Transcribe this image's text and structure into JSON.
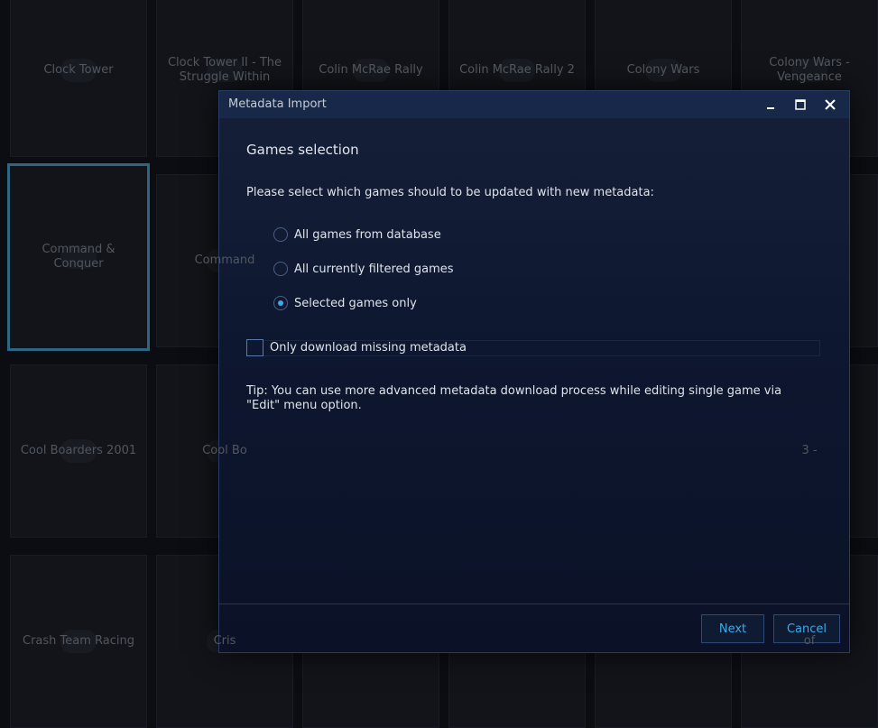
{
  "library": {
    "tiles": [
      {
        "title": "Clock Tower"
      },
      {
        "title": "Clock Tower II - The Struggle Within"
      },
      {
        "title": "Colin McRae Rally"
      },
      {
        "title": "Colin McRae Rally 2"
      },
      {
        "title": "Colony Wars"
      },
      {
        "title": "Colony Wars - Vengeance"
      },
      {
        "title": "Command & Conquer"
      },
      {
        "title": "Command"
      },
      {
        "title": ""
      },
      {
        "title": ""
      },
      {
        "title": ""
      },
      {
        "title": ""
      },
      {
        "title": "Cool Boarders 2001"
      },
      {
        "title": "Cool Bo"
      },
      {
        "title": ""
      },
      {
        "title": ""
      },
      {
        "title": ""
      },
      {
        "title": "3 -"
      },
      {
        "title": "Crash Team Racing"
      },
      {
        "title": "Cris"
      },
      {
        "title": ""
      },
      {
        "title": ""
      },
      {
        "title": ""
      },
      {
        "title": "of"
      }
    ],
    "selected_index": 6
  },
  "dialog": {
    "title": "Metadata Import",
    "section_title": "Games selection",
    "prompt": "Please select which games should to be updated with new metadata:",
    "options": [
      {
        "label": "All games from database",
        "checked": false
      },
      {
        "label": "All currently filtered games",
        "checked": false
      },
      {
        "label": "Selected games only",
        "checked": true
      }
    ],
    "checkbox": {
      "label": "Only download missing metadata",
      "checked": false
    },
    "tip": "Tip: You can use more advanced metadata download process while editing single game via \"Edit\" menu option.",
    "buttons": {
      "next": "Next",
      "cancel": "Cancel"
    }
  },
  "colors": {
    "accent": "#3fa8e8",
    "dialog_bg": "#0e1730",
    "titlebar": "#172848"
  }
}
